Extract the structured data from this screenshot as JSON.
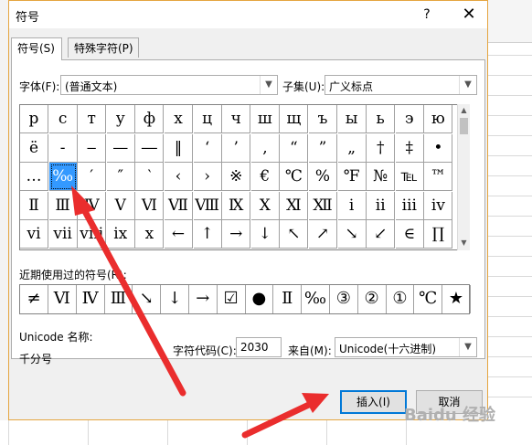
{
  "dialog": {
    "title": "符号",
    "help": "?",
    "close": "✕"
  },
  "tabs": [
    {
      "label": "符号(S)",
      "active": true
    },
    {
      "label": "特殊字符(P)",
      "active": false
    }
  ],
  "font": {
    "label": "字体(F):",
    "value": "(普通文本)"
  },
  "subset": {
    "label": "子集(U):",
    "value": "广义标点"
  },
  "grid_rows": [
    [
      "р",
      "с",
      "т",
      "у",
      "ф",
      "х",
      "ц",
      "ч",
      "ш",
      "щ",
      "ъ",
      "ы",
      "ь",
      "э",
      "ю",
      "я"
    ],
    [
      "ё",
      "-",
      "‒",
      "—",
      "―",
      "‖",
      "‘",
      "’",
      "‚",
      "“",
      "”",
      "„",
      "†",
      "‡",
      "•",
      "‥"
    ],
    [
      "…",
      "‰",
      "′",
      "″",
      "‵",
      "‹",
      "›",
      "※",
      "€",
      "℃",
      "%",
      "℉",
      "№",
      "℡",
      "™",
      "Ⅰ"
    ],
    [
      "Ⅱ",
      "Ⅲ",
      "Ⅳ",
      "Ⅴ",
      "Ⅵ",
      "Ⅶ",
      "Ⅷ",
      "Ⅸ",
      "Ⅹ",
      "Ⅺ",
      "Ⅻ",
      "ⅰ",
      "ⅱ",
      "ⅲ",
      "ⅳ",
      "ⅴ"
    ],
    [
      "ⅵ",
      "ⅶ",
      "ⅷ",
      "ⅸ",
      "ⅹ",
      "←",
      "↑",
      "→",
      "↓",
      "↖",
      "↗",
      "↘",
      "↙",
      "∈",
      "∏",
      "∑"
    ]
  ],
  "selected": {
    "row": 2,
    "col": 1
  },
  "recent": {
    "label": "近期使用过的符号(R):",
    "items": [
      "≠",
      "Ⅵ",
      "Ⅳ",
      "Ⅲ",
      "↘",
      "↓",
      "→",
      "☑",
      "●",
      "Ⅱ",
      "‰",
      "③",
      "②",
      "①",
      "℃",
      "★"
    ]
  },
  "unicode_name": {
    "label": "Unicode 名称:",
    "value": "千分号"
  },
  "char_code": {
    "label": "字符代码(C):",
    "value": "2030"
  },
  "from": {
    "label": "来自(M):",
    "value": "Unicode(十六进制)"
  },
  "buttons": {
    "insert": "插入(I)",
    "cancel": "取消"
  },
  "watermark": "Baidu 经验"
}
